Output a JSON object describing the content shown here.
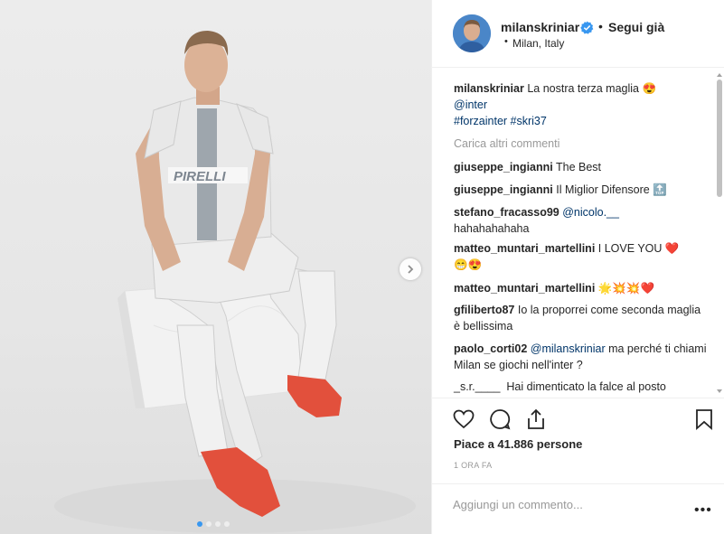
{
  "post": {
    "username": "milanskriniar",
    "follow_bullet": "•",
    "follow_label": "Segui già",
    "location_bullet": "•",
    "location": "Milan, Italy",
    "caption": {
      "user": "milanskriniar",
      "text": "La nostra terza maglia",
      "emoji": "😍",
      "mention": "@inter",
      "hashtags": "#forzainter #skri37"
    },
    "load_more": "Carica altri commenti",
    "comments": [
      {
        "user": "giuseppe_ingianni",
        "text": "The Best"
      },
      {
        "user": "giuseppe_ingianni",
        "text": "Il Miglior Difensore",
        "emoji": "🔝"
      },
      {
        "user": "stefano_fracasso99",
        "mention": "@nicolo.__",
        "text": "hahahahahaha"
      },
      {
        "user": "matteo_muntari_martellini",
        "text": "I LOVE YOU",
        "emoji": "❤️",
        "emoji2": "😁😍"
      },
      {
        "user": "matteo_muntari_martellini",
        "emoji": "🌟💥💥❤️"
      },
      {
        "user": "gfiliberto87",
        "text": "Io la proporrei come seconda maglia è bellissima"
      },
      {
        "user": "paolo_corti02",
        "mention": "@milanskriniar",
        "text": "ma perché ti chiami Milan se giochi nell'inter ?"
      },
      {
        "user": "_s.r.____",
        "text": "Hai dimenticato la falce al posto"
      }
    ],
    "likes": "Piace a 41.886 persone",
    "time": "1 ORA FA",
    "add_comment_placeholder": "Aggiungi un commento...",
    "more_options": "•••"
  },
  "carousel": {
    "slides": 4,
    "active": 0
  },
  "icons": {
    "like": "heart-icon",
    "comment": "comment-icon",
    "share": "share-icon",
    "save": "bookmark-icon",
    "next": "chevron-right-icon",
    "verified": "verified-badge-icon"
  },
  "colors": {
    "link": "#003569",
    "verified": "#3897f0",
    "muted": "#999999",
    "text": "#262626"
  }
}
